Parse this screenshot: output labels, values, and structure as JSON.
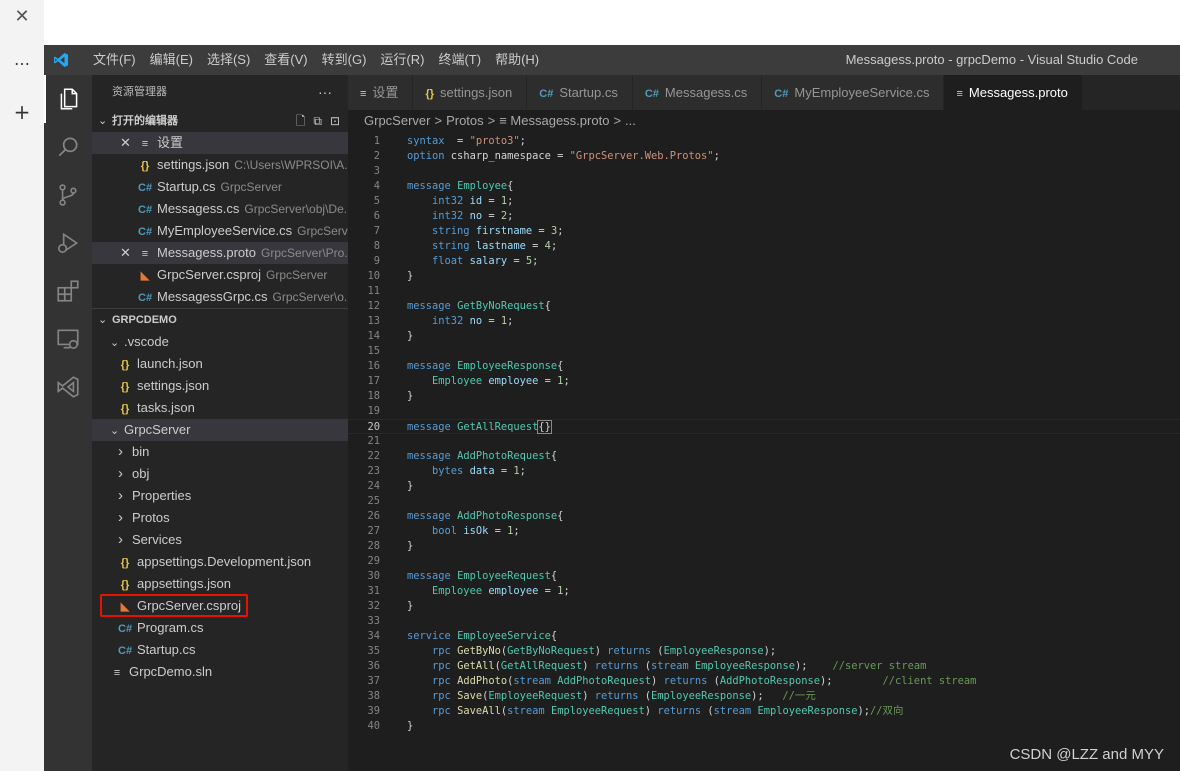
{
  "outer": {
    "close_glyph": "✕",
    "more_glyph": "…",
    "add_glyph": "+"
  },
  "titlebar": {
    "menu": [
      "文件(F)",
      "编辑(E)",
      "选择(S)",
      "查看(V)",
      "转到(G)",
      "运行(R)",
      "终端(T)",
      "帮助(H)"
    ],
    "window_title": "Messagess.proto - grpcDemo - Visual Studio Code"
  },
  "activity_icons": [
    "explorer-icon",
    "search-icon",
    "source-control-icon",
    "run-debug-icon",
    "extensions-icon",
    "remote-explorer-icon",
    "visual-studio-icon"
  ],
  "sidebar": {
    "header": "资源管理器",
    "more": "···",
    "open_editors": {
      "title": "打开的编辑器",
      "items": [
        {
          "icon": "≡",
          "type": "proto",
          "label": "设置",
          "desc": "",
          "closable": true,
          "selected": true
        },
        {
          "icon": "{}",
          "type": "json",
          "label": "settings.json",
          "desc": "C:\\Users\\WPRSOI\\A...",
          "closable": false,
          "selected": false
        },
        {
          "icon": "C#",
          "type": "cs",
          "label": "Startup.cs",
          "desc": "GrpcServer",
          "closable": false,
          "selected": false
        },
        {
          "icon": "C#",
          "type": "cs",
          "label": "Messagess.cs",
          "desc": "GrpcServer\\obj\\De...",
          "closable": false,
          "selected": false
        },
        {
          "icon": "C#",
          "type": "cs",
          "label": "MyEmployeeService.cs",
          "desc": "GrpcServ...",
          "closable": false,
          "selected": false
        },
        {
          "icon": "≡",
          "type": "proto",
          "label": "Messagess.proto",
          "desc": "GrpcServer\\Pro...",
          "closable": true,
          "selected": true
        },
        {
          "icon": "◣",
          "type": "xml",
          "label": "GrpcServer.csproj",
          "desc": "GrpcServer",
          "closable": false,
          "selected": false
        },
        {
          "icon": "C#",
          "type": "cs",
          "label": "MessagessGrpc.cs",
          "desc": "GrpcServer\\o...",
          "closable": false,
          "selected": false
        }
      ]
    },
    "workspace": {
      "title": "GRPCDEMO",
      "tree": [
        {
          "depth": 1,
          "folder": true,
          "open": true,
          "label": ".vscode"
        },
        {
          "depth": 2,
          "icon": "{}",
          "type": "json",
          "label": "launch.json"
        },
        {
          "depth": 2,
          "icon": "{}",
          "type": "json",
          "label": "settings.json"
        },
        {
          "depth": 2,
          "icon": "{}",
          "type": "json",
          "label": "tasks.json"
        },
        {
          "depth": 1,
          "folder": true,
          "open": true,
          "label": "GrpcServer",
          "selected": true
        },
        {
          "depth": 2,
          "folder": true,
          "open": false,
          "label": "bin"
        },
        {
          "depth": 2,
          "folder": true,
          "open": false,
          "label": "obj"
        },
        {
          "depth": 2,
          "folder": true,
          "open": false,
          "label": "Properties"
        },
        {
          "depth": 2,
          "folder": true,
          "open": false,
          "label": "Protos"
        },
        {
          "depth": 2,
          "folder": true,
          "open": false,
          "label": "Services"
        },
        {
          "depth": 2,
          "icon": "{}",
          "type": "json",
          "label": "appsettings.Development.json"
        },
        {
          "depth": 2,
          "icon": "{}",
          "type": "json",
          "label": "appsettings.json"
        },
        {
          "depth": 2,
          "icon": "◣",
          "type": "xml",
          "label": "GrpcServer.csproj",
          "highlighted": true
        },
        {
          "depth": 2,
          "icon": "C#",
          "type": "cs",
          "label": "Program.cs"
        },
        {
          "depth": 2,
          "icon": "C#",
          "type": "cs",
          "label": "Startup.cs"
        },
        {
          "depth": 1,
          "icon": "≡",
          "type": "sln",
          "label": "GrpcDemo.sln"
        }
      ]
    }
  },
  "tabs": [
    {
      "icon": "≡",
      "type": "proto",
      "label": "设置",
      "active": false
    },
    {
      "icon": "{}",
      "type": "json",
      "label": "settings.json",
      "active": false
    },
    {
      "icon": "C#",
      "type": "cs",
      "label": "Startup.cs",
      "active": false
    },
    {
      "icon": "C#",
      "type": "cs",
      "label": "Messagess.cs",
      "active": false
    },
    {
      "icon": "C#",
      "type": "cs",
      "label": "MyEmployeeService.cs",
      "active": false
    },
    {
      "icon": "≡",
      "type": "proto",
      "label": "Messagess.proto",
      "active": true
    }
  ],
  "breadcrumb": [
    "GrpcServer",
    ">",
    "Protos",
    ">",
    "≡ Messagess.proto",
    ">",
    "..."
  ],
  "editor": {
    "current_line": 20,
    "lines": [
      [
        [
          "kw",
          "syntax"
        ],
        [
          "",
          "  = "
        ],
        [
          "str",
          "\"proto3\""
        ],
        [
          "",
          ";"
        ]
      ],
      [
        [
          "kw",
          "option"
        ],
        [
          "",
          " csharp_namespace = "
        ],
        [
          "str",
          "\"GrpcServer.Web.Protos\""
        ],
        [
          "",
          ";"
        ]
      ],
      [],
      [
        [
          "kw",
          "message"
        ],
        [
          "",
          " "
        ],
        [
          "ty",
          "Employee"
        ],
        [
          "",
          "{"
        ]
      ],
      [
        [
          "",
          "    "
        ],
        [
          "kw",
          "int32"
        ],
        [
          "",
          " "
        ],
        [
          "var",
          "id"
        ],
        [
          "",
          " = "
        ],
        [
          "num",
          "1"
        ],
        [
          "",
          ";"
        ]
      ],
      [
        [
          "",
          "    "
        ],
        [
          "kw",
          "int32"
        ],
        [
          "",
          " "
        ],
        [
          "var",
          "no"
        ],
        [
          "",
          " = "
        ],
        [
          "num",
          "2"
        ],
        [
          "",
          ";"
        ]
      ],
      [
        [
          "",
          "    "
        ],
        [
          "kw",
          "string"
        ],
        [
          "",
          " "
        ],
        [
          "var",
          "firstname"
        ],
        [
          "",
          " = "
        ],
        [
          "num",
          "3"
        ],
        [
          "",
          ";"
        ]
      ],
      [
        [
          "",
          "    "
        ],
        [
          "kw",
          "string"
        ],
        [
          "",
          " "
        ],
        [
          "var",
          "lastname"
        ],
        [
          "",
          " = "
        ],
        [
          "num",
          "4"
        ],
        [
          "",
          ";"
        ]
      ],
      [
        [
          "",
          "    "
        ],
        [
          "kw",
          "float"
        ],
        [
          "",
          " "
        ],
        [
          "var",
          "salary"
        ],
        [
          "",
          " = "
        ],
        [
          "num",
          "5"
        ],
        [
          "",
          ";"
        ]
      ],
      [
        [
          "",
          "}"
        ]
      ],
      [],
      [
        [
          "kw",
          "message"
        ],
        [
          "",
          " "
        ],
        [
          "ty",
          "GetByNoRequest"
        ],
        [
          "",
          "{"
        ]
      ],
      [
        [
          "",
          "    "
        ],
        [
          "kw",
          "int32"
        ],
        [
          "",
          " "
        ],
        [
          "var",
          "no"
        ],
        [
          "",
          " = "
        ],
        [
          "num",
          "1"
        ],
        [
          "",
          ";"
        ]
      ],
      [
        [
          "",
          "}"
        ]
      ],
      [],
      [
        [
          "kw",
          "message"
        ],
        [
          "",
          " "
        ],
        [
          "ty",
          "EmployeeResponse"
        ],
        [
          "",
          "{"
        ]
      ],
      [
        [
          "",
          "    "
        ],
        [
          "ty",
          "Employee"
        ],
        [
          "",
          " "
        ],
        [
          "var",
          "employee"
        ],
        [
          "",
          " = "
        ],
        [
          "num",
          "1"
        ],
        [
          "",
          ";"
        ]
      ],
      [
        [
          "",
          "}"
        ]
      ],
      [],
      [
        [
          "kw",
          "message"
        ],
        [
          "",
          " "
        ],
        [
          "ty",
          "GetAllRequest"
        ],
        [
          "hl",
          "{}"
        ]
      ],
      [],
      [
        [
          "kw",
          "message"
        ],
        [
          "",
          " "
        ],
        [
          "ty",
          "AddPhotoRequest"
        ],
        [
          "",
          "{"
        ]
      ],
      [
        [
          "",
          "    "
        ],
        [
          "kw",
          "bytes"
        ],
        [
          "",
          " "
        ],
        [
          "var",
          "data"
        ],
        [
          "",
          " = "
        ],
        [
          "num",
          "1"
        ],
        [
          "",
          ";"
        ]
      ],
      [
        [
          "",
          "}"
        ]
      ],
      [],
      [
        [
          "kw",
          "message"
        ],
        [
          "",
          " "
        ],
        [
          "ty",
          "AddPhotoResponse"
        ],
        [
          "",
          "{"
        ]
      ],
      [
        [
          "",
          "    "
        ],
        [
          "kw",
          "bool"
        ],
        [
          "",
          " "
        ],
        [
          "var",
          "isOk"
        ],
        [
          "",
          " = "
        ],
        [
          "num",
          "1"
        ],
        [
          "",
          ";"
        ]
      ],
      [
        [
          "",
          "}"
        ]
      ],
      [],
      [
        [
          "kw",
          "message"
        ],
        [
          "",
          " "
        ],
        [
          "ty",
          "EmployeeRequest"
        ],
        [
          "",
          "{"
        ]
      ],
      [
        [
          "",
          "    "
        ],
        [
          "ty",
          "Employee"
        ],
        [
          "",
          " "
        ],
        [
          "var",
          "employee"
        ],
        [
          "",
          " = "
        ],
        [
          "num",
          "1"
        ],
        [
          "",
          ";"
        ]
      ],
      [
        [
          "",
          "}"
        ]
      ],
      [],
      [
        [
          "kw",
          "service"
        ],
        [
          "",
          " "
        ],
        [
          "ty",
          "EmployeeService"
        ],
        [
          "",
          "{"
        ]
      ],
      [
        [
          "",
          "    "
        ],
        [
          "kw",
          "rpc"
        ],
        [
          "",
          " "
        ],
        [
          "fn",
          "GetByNo"
        ],
        [
          "",
          "("
        ],
        [
          "ty",
          "GetByNoRequest"
        ],
        [
          "",
          ") "
        ],
        [
          "kw",
          "returns"
        ],
        [
          "",
          " ("
        ],
        [
          "ty",
          "EmployeeResponse"
        ],
        [
          "",
          ");"
        ]
      ],
      [
        [
          "",
          "    "
        ],
        [
          "kw",
          "rpc"
        ],
        [
          "",
          " "
        ],
        [
          "fn",
          "GetAll"
        ],
        [
          "",
          "("
        ],
        [
          "ty",
          "GetAllRequest"
        ],
        [
          "",
          ") "
        ],
        [
          "kw",
          "returns"
        ],
        [
          "",
          " ("
        ],
        [
          "kw",
          "stream"
        ],
        [
          "",
          " "
        ],
        [
          "ty",
          "EmployeeResponse"
        ],
        [
          "",
          ");    "
        ],
        [
          "cm",
          "//server stream"
        ]
      ],
      [
        [
          "",
          "    "
        ],
        [
          "kw",
          "rpc"
        ],
        [
          "",
          " "
        ],
        [
          "fn",
          "AddPhoto"
        ],
        [
          "",
          "("
        ],
        [
          "kw",
          "stream"
        ],
        [
          "",
          " "
        ],
        [
          "ty",
          "AddPhotoRequest"
        ],
        [
          "",
          ") "
        ],
        [
          "kw",
          "returns"
        ],
        [
          "",
          " ("
        ],
        [
          "ty",
          "AddPhotoResponse"
        ],
        [
          "",
          ");        "
        ],
        [
          "cm",
          "//client stream"
        ]
      ],
      [
        [
          "",
          "    "
        ],
        [
          "kw",
          "rpc"
        ],
        [
          "",
          " "
        ],
        [
          "fn",
          "Save"
        ],
        [
          "",
          "("
        ],
        [
          "ty",
          "EmployeeRequest"
        ],
        [
          "",
          ") "
        ],
        [
          "kw",
          "returns"
        ],
        [
          "",
          " ("
        ],
        [
          "ty",
          "EmployeeResponse"
        ],
        [
          "",
          ");   "
        ],
        [
          "cm",
          "//一元"
        ]
      ],
      [
        [
          "",
          "    "
        ],
        [
          "kw",
          "rpc"
        ],
        [
          "",
          " "
        ],
        [
          "fn",
          "SaveAll"
        ],
        [
          "",
          "("
        ],
        [
          "kw",
          "stream"
        ],
        [
          "",
          " "
        ],
        [
          "ty",
          "EmployeeRequest"
        ],
        [
          "",
          ") "
        ],
        [
          "kw",
          "returns"
        ],
        [
          "",
          " ("
        ],
        [
          "kw",
          "stream"
        ],
        [
          "",
          " "
        ],
        [
          "ty",
          "EmployeeResponse"
        ],
        [
          "",
          ");"
        ],
        [
          "cm",
          "//双向"
        ]
      ],
      [
        [
          "",
          "}"
        ]
      ]
    ]
  },
  "watermark": "CSDN @LZZ and MYY",
  "colors": {
    "accent_red": "#e51400",
    "editor_bg": "#1e1e1e",
    "sidebar_bg": "#252526",
    "activity_bg": "#333333",
    "titlebar_bg": "#3c3c3c"
  }
}
